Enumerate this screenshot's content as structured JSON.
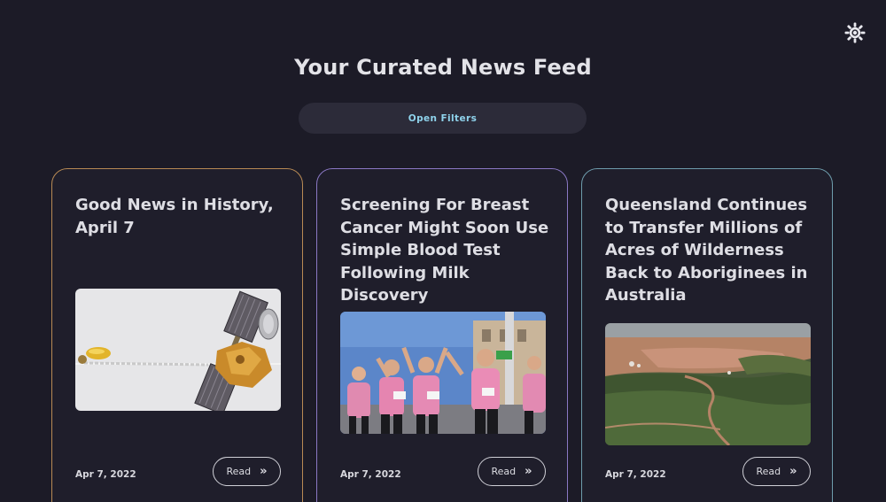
{
  "header": {
    "title": "Your Curated News Feed",
    "filters_label": "Open Filters"
  },
  "theme_toggle_icon": "sun-icon",
  "colors": {
    "background": "#1c1b27",
    "card_background": "#1f1e2b",
    "filters_text": "#8fd3ec",
    "card_borders": [
      "#b88a54",
      "#8a78c4",
      "#6e9cac"
    ]
  },
  "articles": [
    {
      "title": "Good News in History, April 7",
      "date": "Apr 7, 2022",
      "read_label": "Read",
      "read_icon": "double-chevron-right-icon",
      "image": "satellite-image"
    },
    {
      "title": "Screening For Breast Cancer Might Soon Use Simple Blood Test Following Milk Discovery",
      "date": "Apr 7, 2022",
      "read_label": "Read",
      "read_icon": "double-chevron-right-icon",
      "image": "women-running-race-photo"
    },
    {
      "title": "Queensland Continues to Transfer Millions of Acres of Wilderness Back to Aboriginees in Australia",
      "date": "Apr 7, 2022",
      "read_label": "Read",
      "read_icon": "double-chevron-right-icon",
      "image": "aerial-wilderness-photo"
    }
  ]
}
